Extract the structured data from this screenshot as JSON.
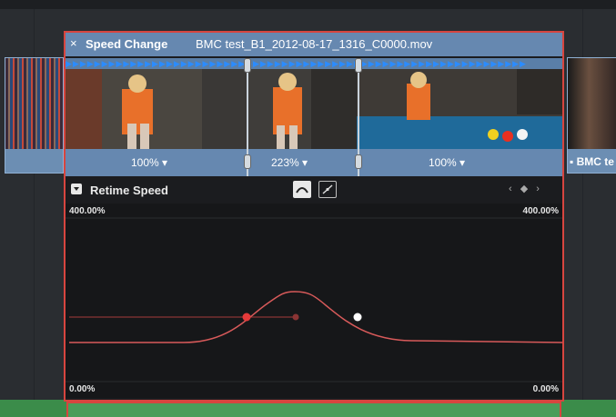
{
  "clip": {
    "title": "Speed Change",
    "filename": "BMC test_B1_2012-08-17_1316_C0000.mov",
    "close_symbol": "×"
  },
  "speed_segments": [
    "100% ▾",
    "223% ▾",
    "100% ▾"
  ],
  "right_clip": {
    "label": "▪ BMC te"
  },
  "retime": {
    "label": "Retime Speed",
    "nav": "‹ ◆ ›"
  },
  "graph": {
    "top_left": "400.00%",
    "top_right": "400.00%",
    "bottom_left": "0.00%",
    "bottom_right": "0.00%"
  },
  "colors": {
    "clip_border": "#d7453f",
    "header_blue": "#6688b0",
    "marker_blue": "#2b8cff",
    "curve": "#d85a5a",
    "bottom_track": "#3b8c4a"
  }
}
